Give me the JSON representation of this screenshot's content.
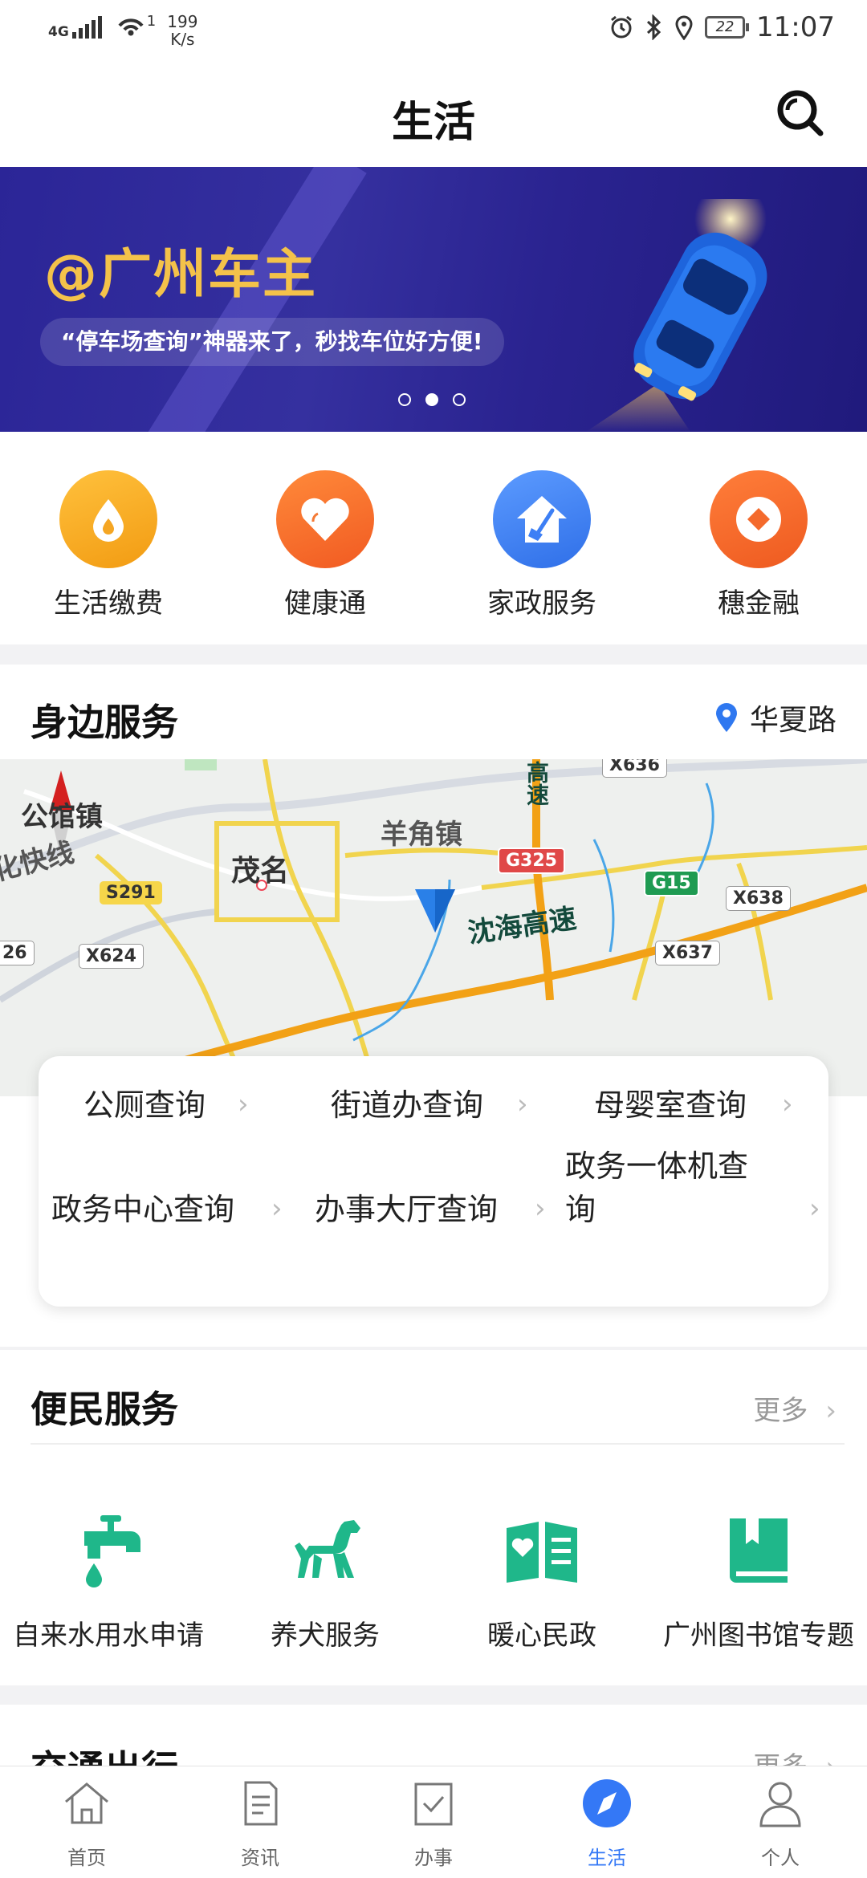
{
  "status_bar": {
    "signal": "4G",
    "wifi_count": "1",
    "speed_value": "199",
    "speed_unit": "K/s",
    "battery": "22",
    "time": "11:07"
  },
  "header": {
    "title": "生活"
  },
  "banner": {
    "title": "@广州车主",
    "subtitle": "“停车场查询”神器来了，秒找车位好方便!",
    "dots_total": 3,
    "active_dot": 2
  },
  "quick_services": [
    {
      "label": "生活缴费",
      "icon": "water-drop-icon",
      "color": "#f5a623"
    },
    {
      "label": "健康通",
      "icon": "heart-icon",
      "color": "#f76b27"
    },
    {
      "label": "家政服务",
      "icon": "house-broom-icon",
      "color": "#3d7ff5"
    },
    {
      "label": "穗金融",
      "icon": "diamond-icon",
      "color": "#f46a2c"
    }
  ],
  "nearby": {
    "title": "身边服务",
    "location": "华夏路",
    "map": {
      "labels": [
        "公馆镇",
        "茂名",
        "羊角镇",
        "沈海高速",
        "化快线",
        "高速"
      ],
      "road_tags": [
        "X636",
        "S291",
        "G325",
        "G15",
        "X638",
        "X624",
        "X637",
        "26"
      ]
    },
    "services": [
      {
        "label": "公厕查询"
      },
      {
        "label": "街道办查询"
      },
      {
        "label": "母婴室查询"
      },
      {
        "label": "政务中心查询"
      },
      {
        "label": "办事大厅查询"
      },
      {
        "label": "政务一体机查询"
      }
    ]
  },
  "convenience": {
    "title": "便民服务",
    "more": "更多",
    "items": [
      {
        "label": "自来水用水申请",
        "icon": "faucet-icon"
      },
      {
        "label": "养犬服务",
        "icon": "dog-icon"
      },
      {
        "label": "暖心民政",
        "icon": "heart-book-icon"
      },
      {
        "label": "广州图书馆专题",
        "icon": "library-book-icon"
      }
    ],
    "accent": "#1fb78a"
  },
  "traffic": {
    "title": "交通出行",
    "more": "更多"
  },
  "tabbar": {
    "active": "生活",
    "accent": "#3478f6",
    "tabs": [
      {
        "label": "首页",
        "icon": "home-icon"
      },
      {
        "label": "资讯",
        "icon": "news-icon"
      },
      {
        "label": "办事",
        "icon": "checklist-icon"
      },
      {
        "label": "生活",
        "icon": "compass-icon"
      },
      {
        "label": "个人",
        "icon": "person-icon"
      }
    ]
  }
}
